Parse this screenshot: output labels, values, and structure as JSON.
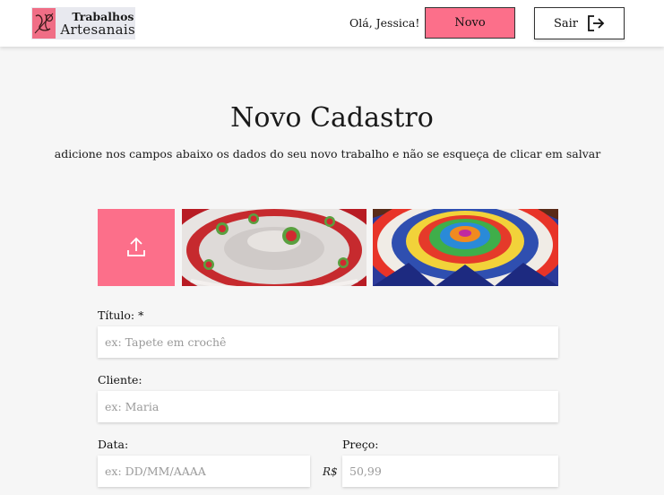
{
  "header": {
    "logo": {
      "line1": "Trabalhos",
      "line2": "Artesanais"
    },
    "greeting": "Olá, Jessica!",
    "novo_label": "Novo",
    "sair_label": "Sair"
  },
  "main": {
    "title": "Novo Cadastro",
    "subtitle": "adicione nos campos abaixo os dados do seu novo trabalho e não se esqueça de clicar em salvar"
  },
  "images": {
    "upload_icon": "upload-icon",
    "photos": [
      "crochet-doily-red-white",
      "crochet-doily-rainbow"
    ]
  },
  "form": {
    "titulo": {
      "label": "Título: *",
      "placeholder": "ex: Tapete em crochê"
    },
    "cliente": {
      "label": "Cliente:",
      "placeholder": "ex: Maria"
    },
    "data": {
      "label": "Data:",
      "placeholder": "ex: DD/MM/AAAA"
    },
    "preco": {
      "label": "Preço:",
      "placeholder": "50,99",
      "currency": "R$"
    }
  },
  "colors": {
    "accent": "#fc6f8a",
    "background": "#f6f6f6"
  }
}
